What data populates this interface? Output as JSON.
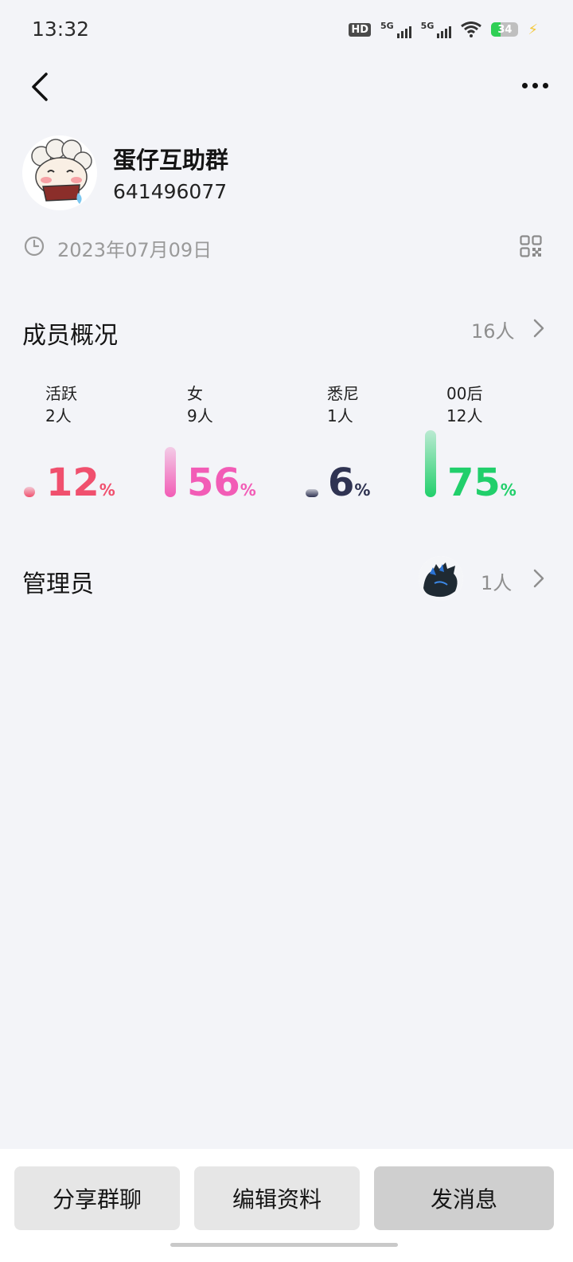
{
  "status_bar": {
    "time": "13:32",
    "hd_label": "HD",
    "net1": "5G",
    "net2": "5G",
    "battery": "34",
    "battery_level": 0.34,
    "battery_color": "#2fcf55"
  },
  "group": {
    "name": "蛋仔互助群",
    "id": "641496077",
    "created": "2023年07月09日"
  },
  "member_overview": {
    "title": "成员概况",
    "total": "16人",
    "stats": [
      {
        "label": "活跃",
        "count": "2人",
        "percent": "12",
        "sign": "%",
        "color": "#f0506e",
        "fraction": 0.12
      },
      {
        "label": "女",
        "count": "9人",
        "percent": "56",
        "sign": "%",
        "color": "#f25cb6",
        "fraction": 0.56
      },
      {
        "label": "悉尼",
        "count": "1人",
        "percent": "6",
        "sign": "%",
        "color": "#2f3352",
        "fraction": 0.06
      },
      {
        "label": "00后",
        "count": "12人",
        "percent": "75",
        "sign": "%",
        "color": "#21cf6b",
        "fraction": 0.75
      }
    ]
  },
  "admin": {
    "title": "管理员",
    "count": "1人"
  },
  "buttons": {
    "share": "分享群聊",
    "edit": "编辑资料",
    "send": "发消息"
  },
  "icons": [
    "back-icon",
    "more-icon",
    "clock-icon",
    "qr-code-icon",
    "chevron-right-icon"
  ]
}
